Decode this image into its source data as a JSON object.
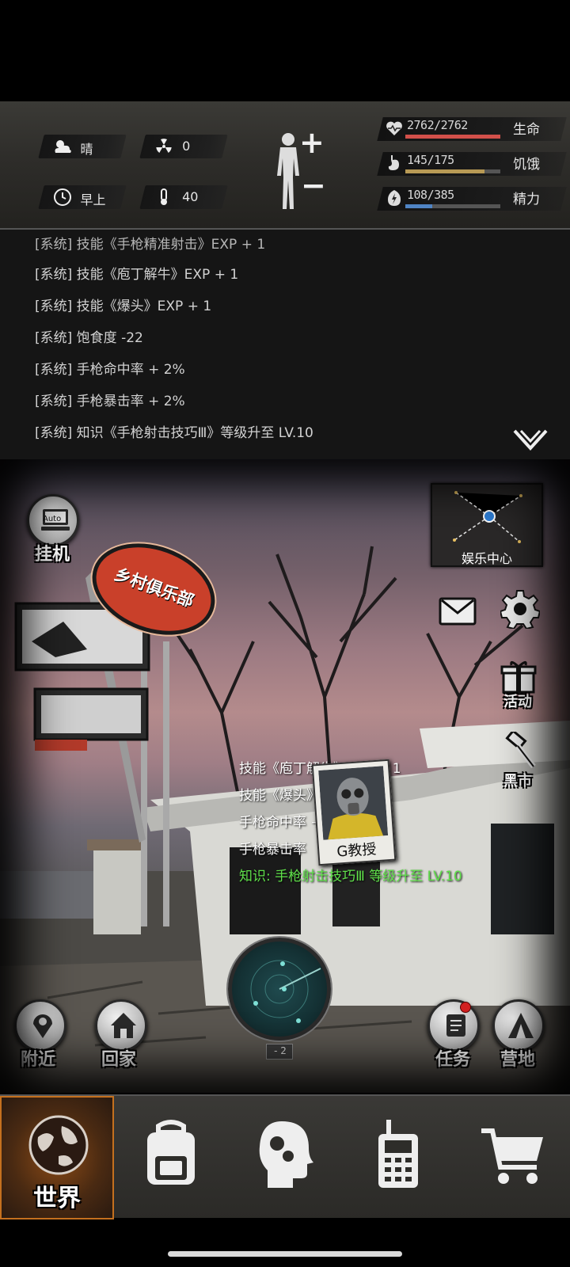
{
  "status": {
    "weather": {
      "icon": "cloud-sun-icon",
      "label": "晴"
    },
    "radiation": {
      "icon": "radiation-icon",
      "value": "0"
    },
    "time": {
      "icon": "clock-icon",
      "label": "早上"
    },
    "temperature": {
      "icon": "thermometer-icon",
      "value": "40"
    },
    "body_button": {
      "icon": "body-status-icon",
      "plus": "+",
      "minus": "−"
    },
    "stats": [
      {
        "icon": "heart-icon",
        "value": "2762/2762",
        "label": "生命",
        "fraction": 1.0,
        "color": "#d2504a"
      },
      {
        "icon": "stomach-icon",
        "value": "145/175",
        "label": "饥饿",
        "fraction": 0.83,
        "color": "#b89a55"
      },
      {
        "icon": "energy-icon",
        "value": "108/385",
        "label": "精力",
        "fraction": 0.28,
        "color": "#4f84c4"
      }
    ]
  },
  "log": {
    "lines": [
      "[系统] 技能《手枪精准射击》EXP + 1",
      "[系统] 技能《庖丁解牛》EXP + 1",
      "[系统] 技能《爆头》EXP + 1",
      "[系统] 饱食度 -22",
      "[系统] 手枪命中率 + 2%",
      "[系统] 手枪暴击率 + 2%",
      "[系统] 知识《手枪射击技巧Ⅲ》等级升至 LV.10"
    ]
  },
  "scene": {
    "sign_text": "乡村俱乐部",
    "auto_button": {
      "icon_text": "Auto",
      "label": "挂机"
    },
    "entertainment": {
      "label": "娱乐中心"
    },
    "side_buttons": {
      "mail": "mail-icon",
      "settings": "gear-icon",
      "activity": "活动",
      "black_market": "黑市"
    },
    "float_messages": [
      "技能《庖丁解牛》EXP + 1",
      "技能《爆头》EXP + 1",
      "手枪命中率 + 2%",
      "手枪暴击率"
    ],
    "float_highlight": "知识: 手枪射击技巧Ⅲ 等级升至 LV.10",
    "npc": {
      "name": "G教授"
    },
    "radar": {
      "level": "- 2"
    },
    "bottom_buttons": {
      "nearby": "附近",
      "home": "回家",
      "quests": "任务",
      "camp": "营地"
    },
    "colors": {
      "highlight_text": "#5fe04a",
      "badge": "#d22020"
    }
  },
  "nav": {
    "world": "世界",
    "items": [
      "backpack-icon",
      "skills-head-icon",
      "radio-icon",
      "cart-icon"
    ]
  }
}
